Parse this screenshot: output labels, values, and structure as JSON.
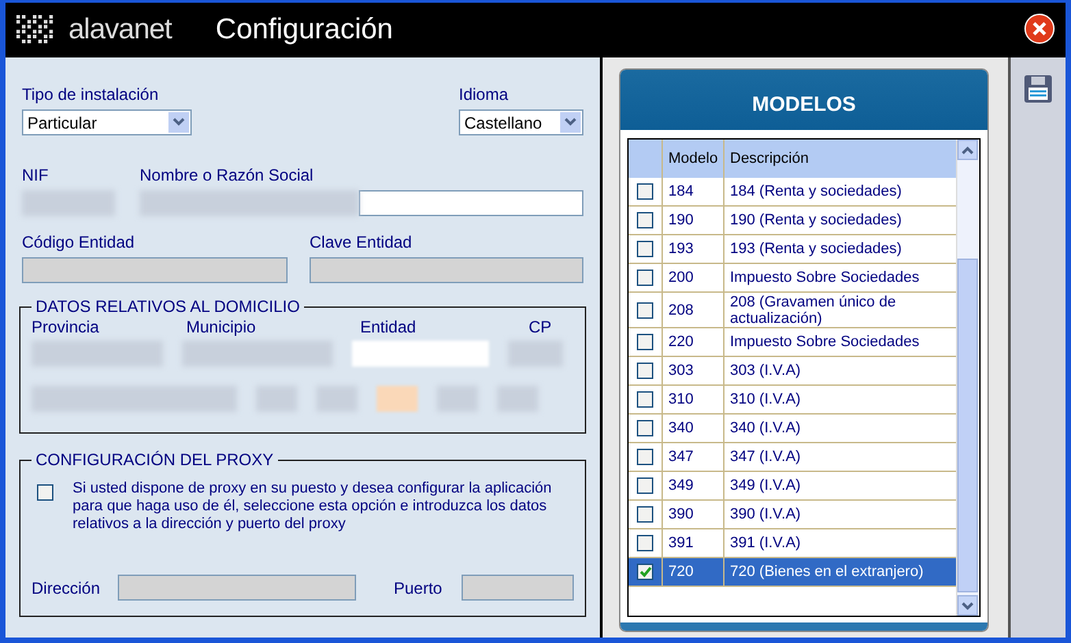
{
  "window": {
    "logo": "alavanet",
    "title": "Configuración"
  },
  "install_type": {
    "label": "Tipo de instalación",
    "value": "Particular"
  },
  "language": {
    "label": "Idioma",
    "value": "Castellano"
  },
  "nif": {
    "label": "NIF"
  },
  "name": {
    "label": "Nombre o Razón Social"
  },
  "entity_code": {
    "label": "Código Entidad"
  },
  "entity_key": {
    "label": "Clave Entidad"
  },
  "address": {
    "legend": "DATOS RELATIVOS AL DOMICILIO",
    "labels": [
      "Provincia",
      "Municipio",
      "Entidad",
      "CP"
    ]
  },
  "proxy": {
    "legend": "CONFIGURACIÓN DEL PROXY",
    "checked": false,
    "description": "Si usted dispone de proxy en su puesto y desea configurar la aplicación para que haga uso de él, seleccione esta opción e introduzca los datos relativos a la dirección y puerto del proxy",
    "address_label": "Dirección",
    "port_label": "Puerto"
  },
  "models": {
    "title": "MODELOS",
    "columns": [
      "Modelo",
      "Descripción"
    ],
    "rows": [
      {
        "code": "184",
        "description": "184 (Renta y sociedades)",
        "checked": false,
        "selected": false
      },
      {
        "code": "190",
        "description": "190 (Renta y sociedades)",
        "checked": false,
        "selected": false
      },
      {
        "code": "193",
        "description": "193 (Renta y sociedades)",
        "checked": false,
        "selected": false
      },
      {
        "code": "200",
        "description": "Impuesto Sobre Sociedades",
        "checked": false,
        "selected": false
      },
      {
        "code": "208",
        "description": "208 (Gravamen único de actualización)",
        "checked": false,
        "selected": false
      },
      {
        "code": "220",
        "description": "Impuesto Sobre Sociedades",
        "checked": false,
        "selected": false
      },
      {
        "code": "303",
        "description": "303 (I.V.A)",
        "checked": false,
        "selected": false
      },
      {
        "code": "310",
        "description": "310 (I.V.A)",
        "checked": false,
        "selected": false
      },
      {
        "code": "340",
        "description": "340 (I.V.A)",
        "checked": false,
        "selected": false
      },
      {
        "code": "347",
        "description": "347 (I.V.A)",
        "checked": false,
        "selected": false
      },
      {
        "code": "349",
        "description": "349 (I.V.A)",
        "checked": false,
        "selected": false
      },
      {
        "code": "390",
        "description": "390 (I.V.A)",
        "checked": false,
        "selected": false
      },
      {
        "code": "391",
        "description": "391 (I.V.A)",
        "checked": false,
        "selected": false
      },
      {
        "code": "720",
        "description": "720 (Bienes en el extranjero)",
        "checked": true,
        "selected": true
      }
    ]
  }
}
